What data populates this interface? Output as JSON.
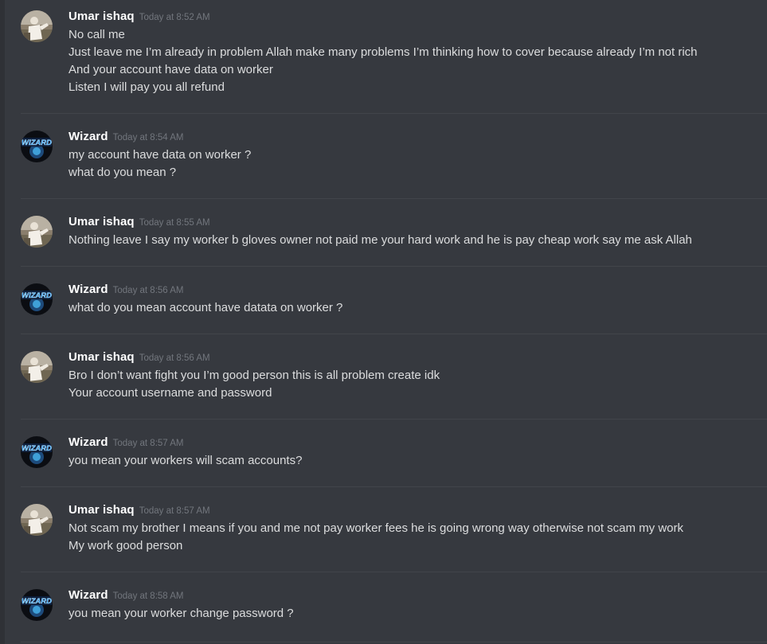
{
  "messages": [
    {
      "author": "Umar ishaq",
      "avatar": "user-photo-avatar",
      "timestamp": "Today at 8:52 AM",
      "lines": [
        "No call me",
        "Just leave me I’m already in problem Allah make many problems I’m thinking how to cover because already I’m not rich",
        "And your account have data on worker",
        "Listen I will pay you all refund"
      ]
    },
    {
      "author": "Wizard",
      "avatar": "wizard-logo-avatar",
      "timestamp": "Today at 8:54 AM",
      "lines": [
        "my account have data on worker ?",
        "what do you mean ?"
      ]
    },
    {
      "author": "Umar ishaq",
      "avatar": "user-photo-avatar",
      "timestamp": "Today at 8:55 AM",
      "lines": [
        "Nothing leave I say my worker b gloves owner not paid me your hard work and he is pay cheap work say me ask Allah"
      ]
    },
    {
      "author": "Wizard",
      "avatar": "wizard-logo-avatar",
      "timestamp": "Today at 8:56 AM",
      "lines": [
        "what do you mean account have datata on worker ?"
      ]
    },
    {
      "author": "Umar ishaq",
      "avatar": "user-photo-avatar",
      "timestamp": "Today at 8:56 AM",
      "lines": [
        "Bro I don’t want fight you I’m good person this is all problem create idk",
        "Your account username and password"
      ]
    },
    {
      "author": "Wizard",
      "avatar": "wizard-logo-avatar",
      "timestamp": "Today at 8:57 AM",
      "lines": [
        "you mean your workers will scam accounts?"
      ]
    },
    {
      "author": "Umar ishaq",
      "avatar": "user-photo-avatar",
      "timestamp": "Today at 8:57 AM",
      "lines": [
        "Not scam my brother I means if you and me not pay worker fees he is going wrong way otherwise not scam my work",
        "My work good person"
      ]
    },
    {
      "author": "Wizard",
      "avatar": "wizard-logo-avatar",
      "timestamp": "Today at 8:58 AM",
      "lines": [
        "you mean your worker change password ?"
      ]
    }
  ],
  "avatar_logo_text": "WIZARD",
  "colors": {
    "background": "#36393f",
    "username": "#ffffff",
    "message_text": "#dcddde",
    "timestamp": "#72767d",
    "divider": "#42454a"
  }
}
